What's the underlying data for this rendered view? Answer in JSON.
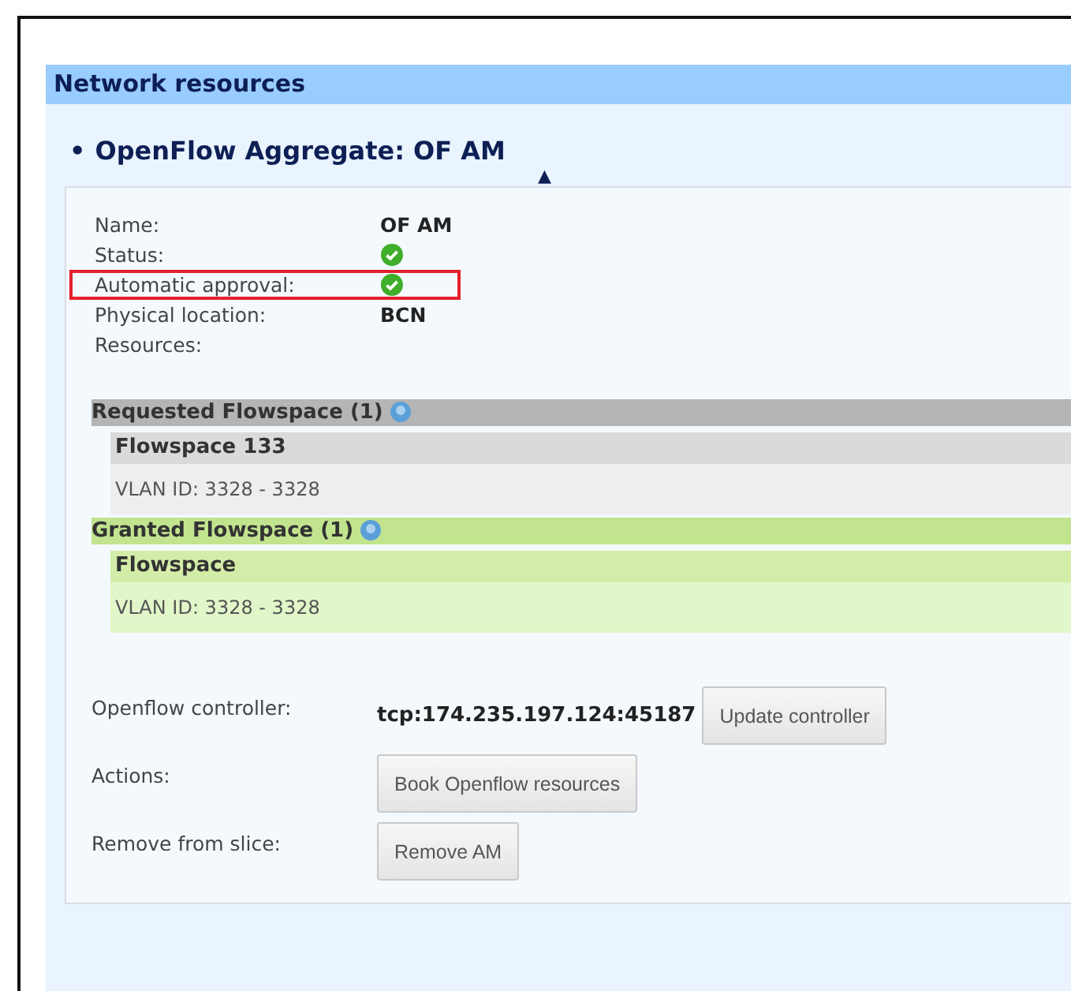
{
  "section_title": "Network resources",
  "aggregate": {
    "title": "OpenFlow Aggregate: OF AM",
    "bullet": "•",
    "toggle": "▲"
  },
  "info_rows": [
    {
      "label": "Name:",
      "kind": "text",
      "value": "OF AM",
      "highlighted": false
    },
    {
      "label": "Status:",
      "kind": "check",
      "highlighted": false
    },
    {
      "label": "Automatic approval:",
      "kind": "check",
      "highlighted": true
    },
    {
      "label": "Physical location:",
      "kind": "text",
      "value": "BCN",
      "highlighted": false
    },
    {
      "label": "Resources:",
      "kind": "none",
      "highlighted": false
    }
  ],
  "flowspace_groups": [
    {
      "kind": "requested",
      "title": "Requested Flowspace (1)",
      "items": [
        {
          "title": "Flowspace 133",
          "detail": "VLAN ID: 3328 - 3328"
        }
      ]
    },
    {
      "kind": "granted",
      "title": "Granted Flowspace (1)",
      "items": [
        {
          "title": "Flowspace",
          "detail": "VLAN ID: 3328 - 3328"
        }
      ]
    }
  ],
  "action_rows": [
    {
      "label": "Openflow controller:",
      "value": "tcp:174.235.197.124:45187",
      "button": "Update controller"
    },
    {
      "label": "Actions:",
      "button": "Book Openflow resources"
    },
    {
      "label": "Remove from slice:",
      "button": "Remove AM"
    }
  ]
}
